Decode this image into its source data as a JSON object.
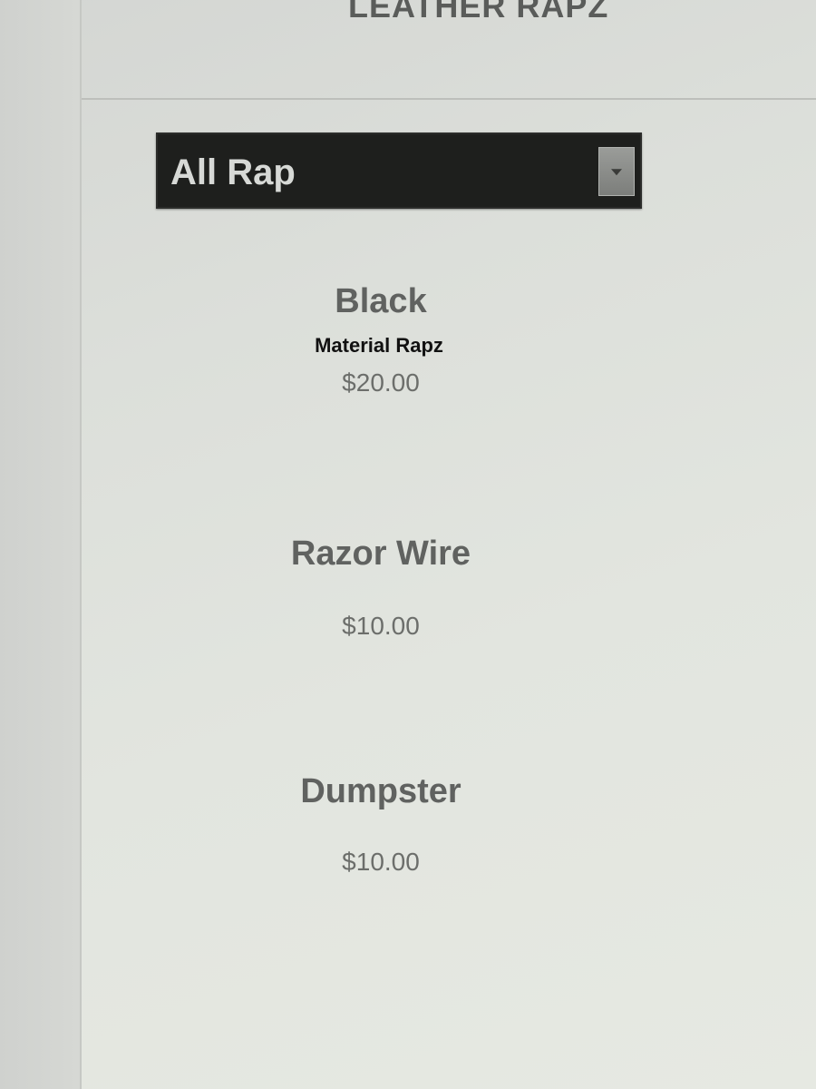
{
  "header": {
    "title": "LEATHER RAPZ"
  },
  "filter": {
    "selected": "All Rap",
    "arrow_icon": "dropdown-arrow-icon"
  },
  "products": [
    {
      "name": "Black",
      "subtitle": "Material Rapz",
      "price": "$20.00"
    },
    {
      "name": "Razor Wire",
      "price": "$10.00"
    },
    {
      "name": "Dumpster",
      "price": "$10.00"
    }
  ]
}
